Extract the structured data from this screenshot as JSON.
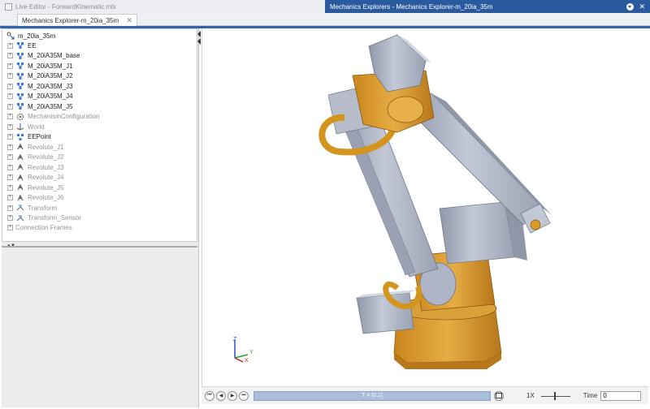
{
  "window": {
    "left_title": "Live Editor - ForwardKinematic.mlx",
    "right_title": "Mechanics Explorers - Mechanics Explorer-m_20ia_35m"
  },
  "tab": {
    "label": "Mechanics Explorer-m_20ia_35m",
    "close": "✕"
  },
  "tree": {
    "root": "m_20ia_35m",
    "items": [
      {
        "label": "EE",
        "muted": false,
        "icon": "frame-icon"
      },
      {
        "label": "M_20iA35M_base",
        "muted": false,
        "icon": "frame-icon"
      },
      {
        "label": "M_20iA35M_J1",
        "muted": false,
        "icon": "frame-icon"
      },
      {
        "label": "M_20iA35M_J2",
        "muted": false,
        "icon": "frame-icon"
      },
      {
        "label": "M_20iA35M_J3",
        "muted": false,
        "icon": "frame-icon"
      },
      {
        "label": "M_20iA35M_J4",
        "muted": false,
        "icon": "frame-icon"
      },
      {
        "label": "M_20iA35M_J5",
        "muted": false,
        "icon": "frame-icon"
      },
      {
        "label": "MechanismConfiguration",
        "muted": true,
        "icon": "gear-icon"
      },
      {
        "label": "World",
        "muted": true,
        "icon": "world-icon"
      },
      {
        "label": "EEPoint",
        "muted": false,
        "icon": "point-icon"
      },
      {
        "label": "Revolute_J1",
        "muted": true,
        "icon": "joint-icon"
      },
      {
        "label": "Revolute_J2",
        "muted": true,
        "icon": "joint-icon"
      },
      {
        "label": "Revolute_J3",
        "muted": true,
        "icon": "joint-icon"
      },
      {
        "label": "Revolute_J4",
        "muted": true,
        "icon": "joint-icon"
      },
      {
        "label": "Revolute_J5",
        "muted": true,
        "icon": "joint-icon"
      },
      {
        "label": "Revolute_J6",
        "muted": true,
        "icon": "joint-icon"
      },
      {
        "label": "Transform",
        "muted": true,
        "icon": "transform-icon"
      },
      {
        "label": "Transform_Sensor",
        "muted": true,
        "icon": "transform-icon"
      }
    ],
    "footer": "Connection Frames"
  },
  "axes": {
    "z": "Z",
    "y": "Y",
    "x": "X"
  },
  "playback": {
    "timeline_label": "T = [0,1]",
    "speed": "1X",
    "time_label": "Time",
    "time_value": "0"
  },
  "colors": {
    "accent": "#2f64ad",
    "robot_orange": "#d99a2b",
    "robot_gray": "#aeb5c6"
  }
}
